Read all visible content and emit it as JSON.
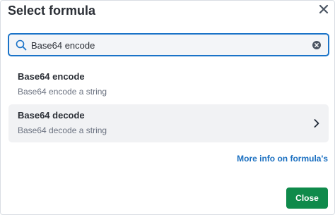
{
  "dialog": {
    "title": "Select formula",
    "close_icon": "close-icon"
  },
  "search": {
    "value": "Base64 encode",
    "icon": "search-icon",
    "clear_icon": "clear-circle-icon"
  },
  "results": [
    {
      "name": "Base64 encode",
      "description": "Base64 encode a string",
      "selected": false
    },
    {
      "name": "Base64 decode",
      "description": "Base64 decode a string",
      "selected": true,
      "icon": "chevron-right-icon"
    }
  ],
  "more_info_label": "More info on formula's",
  "close_label": "Close",
  "colors": {
    "accent": "#1a73c8",
    "link": "#1a6fc0",
    "primary_button": "#0f8a4b",
    "selected_bg": "#f1f2f4"
  }
}
